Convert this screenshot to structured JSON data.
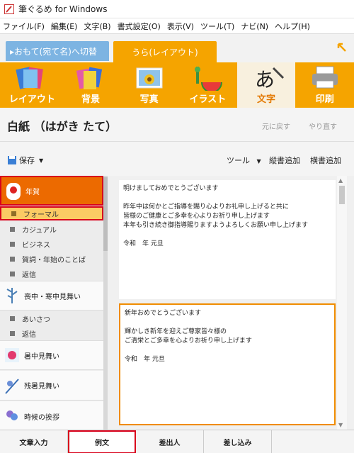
{
  "window": {
    "title": "筆ぐるめ for Windows"
  },
  "menu": [
    "ファイル(F)",
    "編集(E)",
    "文字(B)",
    "書式設定(O)",
    "表示(V)",
    "ツール(T)",
    "ナビ(N)",
    "ヘルプ(H)"
  ],
  "tabs": {
    "switch": "▸おもて(宛て名)へ切替",
    "active": "うら(レイアウト)"
  },
  "toolbar": [
    "レイアウト",
    "背景",
    "写真",
    "イラスト",
    "文字",
    "印刷"
  ],
  "header": {
    "title": "白紙 （はがき たて）",
    "undo": "元に戻す",
    "redo": "やり直す"
  },
  "actions": {
    "save": "保存",
    "tool": "ツール",
    "vertical": "縦書追加",
    "horizontal": "横書追加"
  },
  "sidebar": {
    "cat_newyear": "年賀",
    "newyear_subs": [
      "フォーマル",
      "カジュアル",
      "ビジネス",
      "賀詞・年始のことば",
      "返信"
    ],
    "cat_mourning": "喪中・寒中見舞い",
    "mourning_subs": [
      "あいさつ",
      "返信"
    ],
    "cat_summer": "暑中見舞い",
    "cat_latesummer": "残暑見舞い",
    "cat_seasonal": "時候の挨拶"
  },
  "cards": [
    {
      "p1": "明けましておめでとうございます",
      "p2": "昨年中は何かとご指導を賜り心よりお礼申し上げると共に\n皆様のご健康とご多幸を心よりお祈り申し上げます\n本年も引き続き御指導賜りますようよろしくお願い申し上げます",
      "p3": "令和　年 元旦"
    },
    {
      "p1": "新年おめでとうございます",
      "p2": "輝かしき新年を迎えご尊家皆々様の\nご清栄とご多幸を心よりお祈り申し上げます",
      "p3": "令和　年 元旦"
    }
  ],
  "bottom_tabs": [
    "文章入力",
    "例文",
    "差出人",
    "差し込み"
  ],
  "colors": {
    "accent": "#f5a400",
    "selected": "#ec6a00",
    "highlight": "#d8001a"
  }
}
